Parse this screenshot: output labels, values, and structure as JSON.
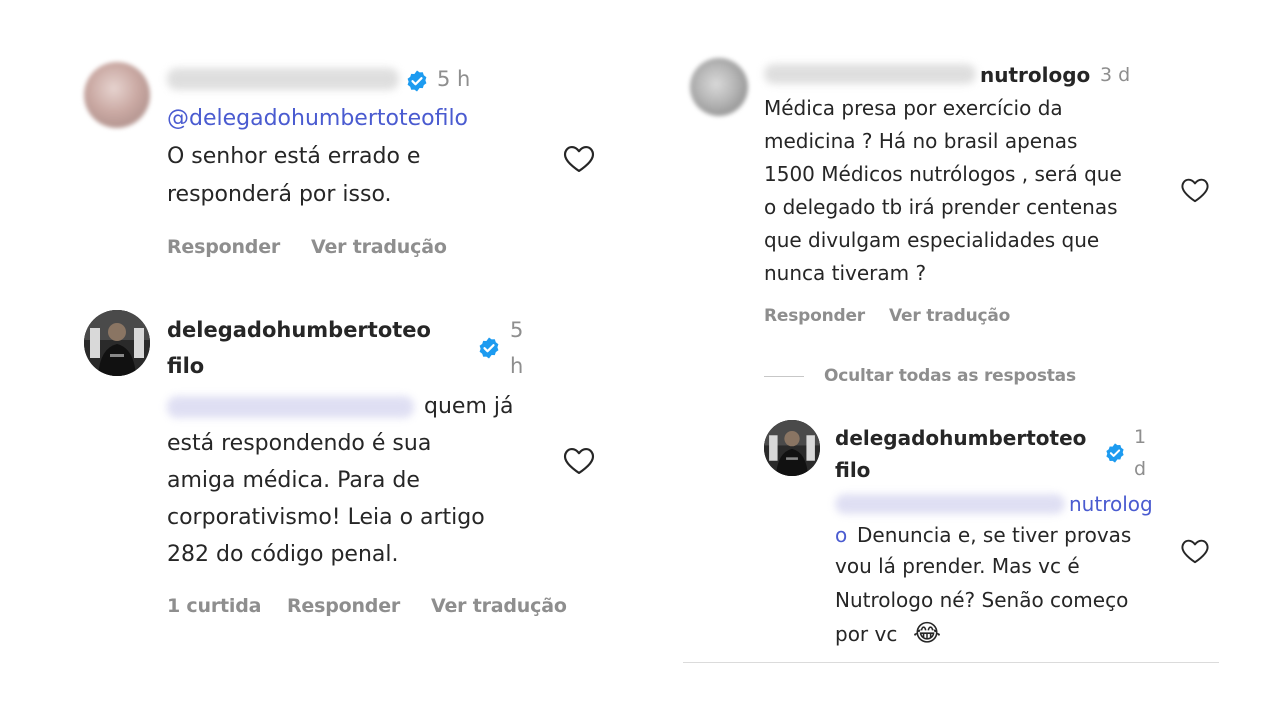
{
  "left": {
    "comment1": {
      "time": "5 h",
      "mention": "@delegadohumbertoteofilo",
      "lines": [
        "O senhor está errado e",
        "responderá por isso."
      ],
      "actions": [
        "Responder",
        "Ver tradução"
      ]
    },
    "comment2": {
      "username_line1": "delegadohumbertoteo",
      "username_line2": "filo",
      "time_line1": "5",
      "time_line2": "h",
      "line1_after_mention": "quem já",
      "lines": [
        "está respondendo é sua",
        "amiga médica. Para de",
        "corporativismo! Leia o artigo",
        "282 do código penal."
      ],
      "actions": [
        "1 curtida",
        "Responder",
        "Ver tradução"
      ]
    }
  },
  "right": {
    "comment1": {
      "username_suffix": "nutrologo",
      "time": "3 d",
      "lines": [
        "Médica presa por exercício da",
        "medicina ? Há no brasil apenas",
        "1500 Médicos nutrólogos , será que",
        "o delegado tb irá prender centenas",
        "que divulgam especialidades que",
        "nunca tiveram ?"
      ],
      "actions": [
        "Responder",
        "Ver tradução"
      ]
    },
    "hide_replies": "Ocultar todas as respostas",
    "reply": {
      "username_line1": "delegadohumbertoteo",
      "username_line2": "filo",
      "time_line1": "1",
      "time_line2": "d",
      "mention_suffix_line1": "nutrolog",
      "mention_suffix_line2": "o",
      "line2_rest": "Denuncia e, se tiver provas",
      "lines": [
        "vou lá prender. Mas vc é",
        "Nutrologo né? Senão começo"
      ],
      "last_line": "por vc",
      "emoji": "😂"
    }
  },
  "colors": {
    "verified": "#1d9bf0",
    "mention": "#4a5bd0",
    "secondary": "#8e8e8e",
    "text": "#262626"
  },
  "icons": {
    "like": "heart-outline-icon",
    "verified": "verified-badge-icon"
  }
}
